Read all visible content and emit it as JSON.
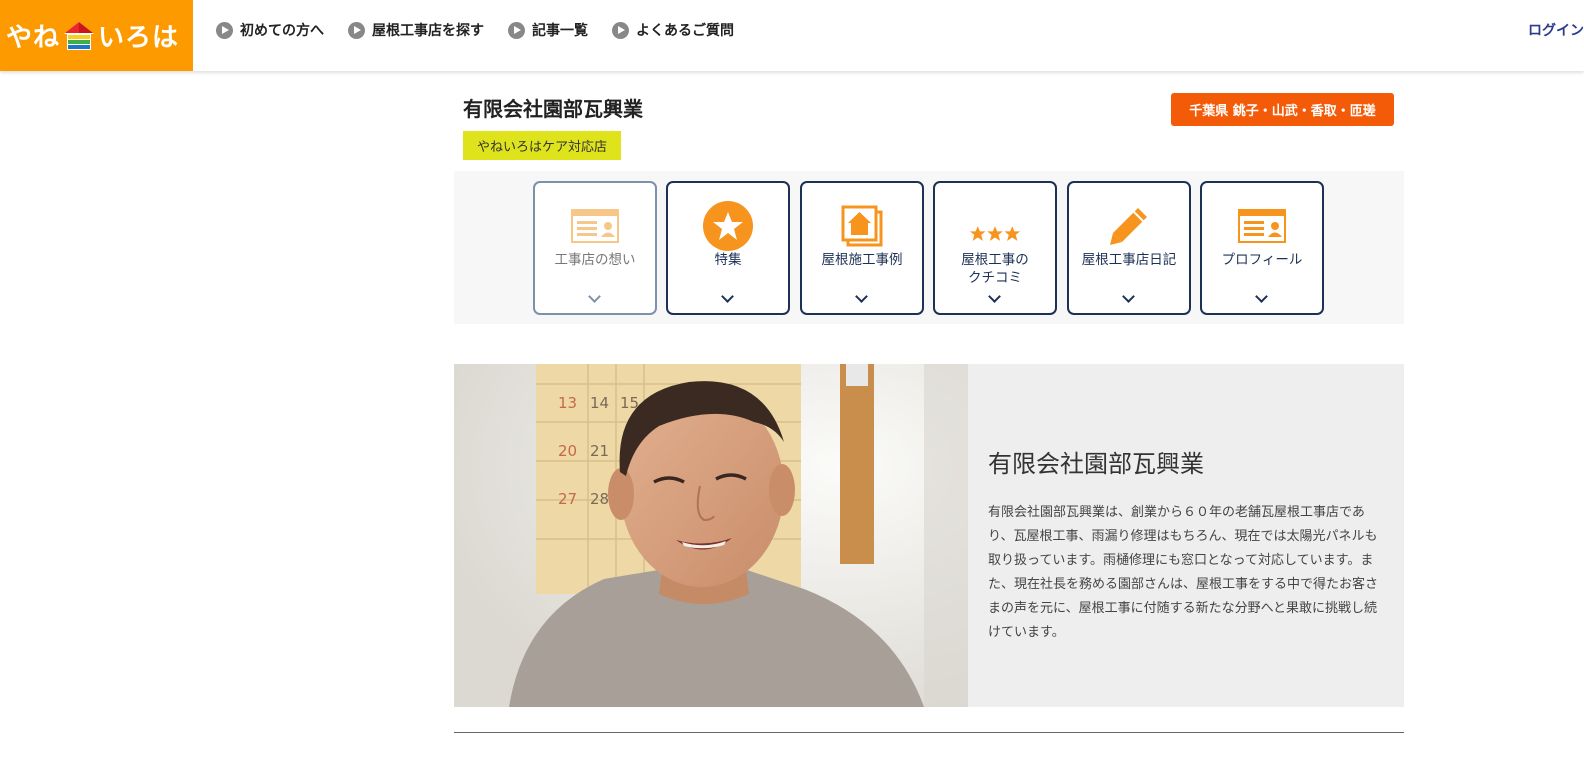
{
  "header": {
    "logo_text_left": "やね",
    "logo_text_right": "いろは",
    "nav": [
      {
        "label": "初めての方へ",
        "icon": "play-circle-icon"
      },
      {
        "label": "屋根工事店を探す",
        "icon": "play-circle-icon"
      },
      {
        "label": "記事一覧",
        "icon": "play-circle-icon"
      },
      {
        "label": "よくあるご質問",
        "icon": "play-circle-icon"
      }
    ],
    "login_label": "ログイン"
  },
  "shop": {
    "title": "有限会社園部瓦興業",
    "care_badge": "やねいろはケア対応店",
    "area_label": "千葉県 銚子・山武・香取・匝瑳"
  },
  "tabs": [
    {
      "label": "工事店の想い",
      "icon": "profile-card-icon"
    },
    {
      "label": "特集",
      "icon": "star-icon"
    },
    {
      "label": "屋根施工事例",
      "icon": "house-gallery-icon"
    },
    {
      "label_line1": "屋根工事の",
      "label_line2": "クチコミ",
      "icon": "three-stars-icon"
    },
    {
      "label": "屋根工事店日記",
      "icon": "pencil-icon"
    },
    {
      "label": "プロフィール",
      "icon": "profile-card-icon"
    }
  ],
  "hero": {
    "name": "有限会社園部瓦興業",
    "description": "有限会社園部瓦興業は、創業から６０年の老舗瓦屋根工事店であり、瓦屋根工事、雨漏り修理はもちろん、現在では太陽光パネルも取り扱っています。雨樋修理にも窓口となって対応しています。また、現在社長を務める園部さんは、屋根工事をする中で得たお客さまの声を元に、屋根工事に付随する新たな分野へと果敢に挑戦し続けています。",
    "calendar_numbers": [
      "13",
      "14",
      "15",
      "20",
      "21",
      "27",
      "28"
    ]
  },
  "colors": {
    "brand_orange": "#fd9a00",
    "area_orange": "#f45b08",
    "badge_yellow": "#dfe31c",
    "navy": "#1d3155"
  }
}
